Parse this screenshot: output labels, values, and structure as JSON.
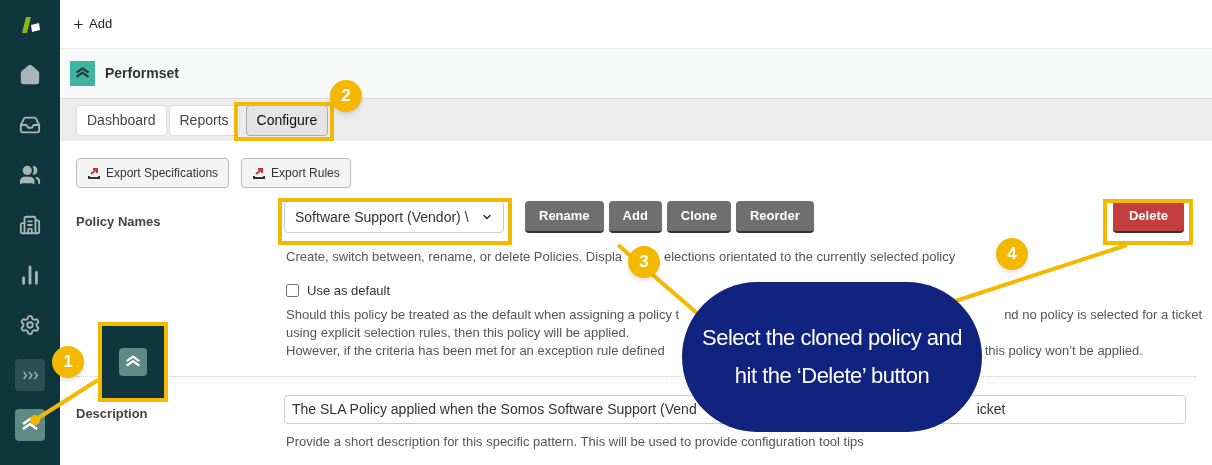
{
  "top_bar": {
    "add_label": "Add"
  },
  "sidebar": {
    "items": [
      {
        "selected": false
      },
      {
        "selected": false
      },
      {
        "selected": false
      },
      {
        "selected": false
      },
      {
        "selected": false
      },
      {
        "selected": false
      },
      {
        "selected": false
      },
      {
        "selected": false
      },
      {
        "selected": true
      }
    ]
  },
  "app": {
    "title": "Performset"
  },
  "tabs": [
    {
      "label": "Dashboard",
      "selected": false
    },
    {
      "label": "Reports",
      "selected": false
    },
    {
      "label": "Configure",
      "selected": true
    }
  ],
  "export_buttons": [
    "Export Specifications",
    "Export Rules"
  ],
  "policy_names": {
    "label": "Policy Names",
    "value": "Software Support (Vendor) \\",
    "buttons": [
      "Rename",
      "Add",
      "Clone",
      "Reorder"
    ],
    "delete_button": "Delete",
    "help_parts": [
      "Create, switch between, rename, or delete Policies. Displa",
      "elections orientated to the currently selected policy"
    ]
  },
  "use_as_default": {
    "label": "Use as default",
    "checked": false,
    "help_lines": [
      [
        "Should this policy be treated as the default when assigning a policy t",
        "nd no policy is selected for a ticket"
      ],
      [
        "using explicit selection rules, then this policy will be applied."
      ],
      [
        "However, if the criteria has been met for an exception rule defined",
        "this policy won’t be applied."
      ]
    ]
  },
  "description": {
    "label": "Description",
    "value_parts": [
      "The SLA Policy applied when the Somos Software Support (Vend",
      "icket"
    ],
    "help": "Provide a short description for this specific pattern. This will be used to provide configuration tool tips"
  },
  "callouts": {
    "badges": [
      "1",
      "2",
      "3",
      "4"
    ],
    "bubble_text": "Select the cloned policy and hit the ‘Delete’ button"
  }
}
